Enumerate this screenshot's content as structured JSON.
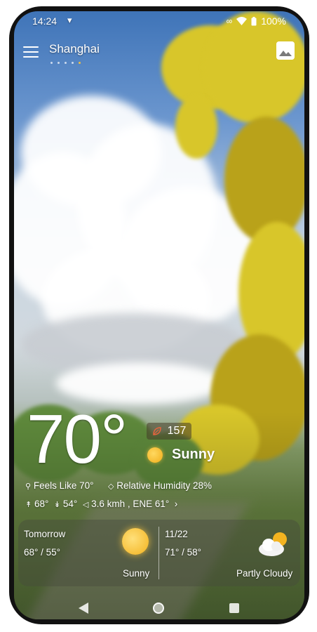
{
  "status": {
    "time": "14:24",
    "battery": "100%"
  },
  "header": {
    "city": "Shanghai",
    "page_dots": 5,
    "active_dot": 4
  },
  "current": {
    "temperature": "70°",
    "aqi": "157",
    "condition": "Sunny",
    "feels_like": "Feels Like 70°",
    "humidity": "Relative Humidity 28%",
    "high": "68°",
    "low": "54°",
    "wind": "3.6 kmh , ENE 61°"
  },
  "forecast": {
    "tomorrow": {
      "label": "Tomorrow",
      "range": "68° / 55°",
      "condition": "Sunny"
    },
    "next": {
      "date": "11/22",
      "range": "71° / 58°",
      "condition": "Partly Cloudy"
    }
  },
  "colors": {
    "accent_dot": "#f0c040",
    "sun": "#f3b21e"
  }
}
